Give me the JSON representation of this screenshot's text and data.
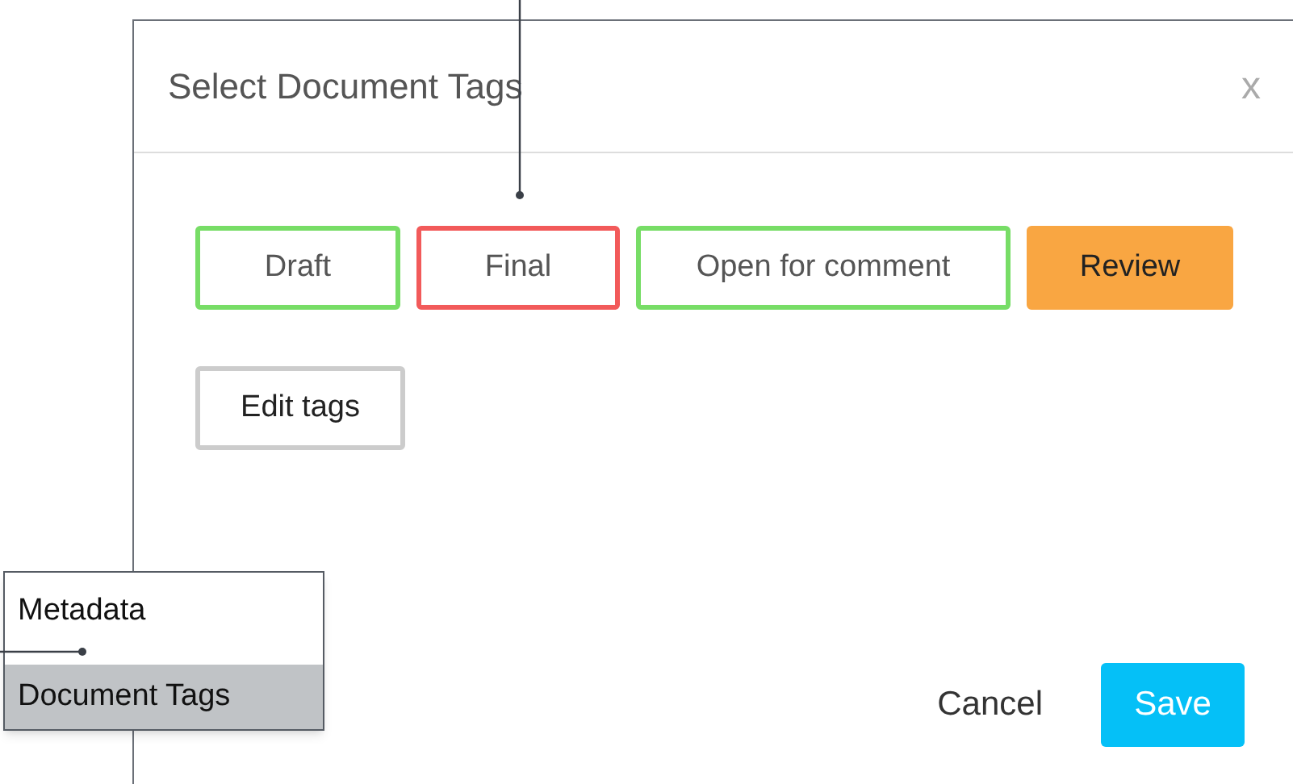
{
  "dialog": {
    "title": "Select Document Tags",
    "close": "x",
    "tags": [
      {
        "label": "Draft",
        "color": "#77dd66",
        "selected": false
      },
      {
        "label": "Final",
        "color": "#f25a5a",
        "selected": false
      },
      {
        "label": "Open for comment",
        "color": "#77dd66",
        "selected": false
      },
      {
        "label": "Review",
        "color": "#f9a642",
        "selected": true
      }
    ],
    "edit_button": "Edit tags",
    "buttons": [
      {
        "label": "Cancel",
        "kind": "text"
      },
      {
        "label": "Save",
        "kind": "primary"
      }
    ]
  },
  "menu": {
    "items": [
      {
        "label": "Metadata",
        "selected": false
      },
      {
        "label": "Document Tags",
        "selected": true
      }
    ]
  }
}
